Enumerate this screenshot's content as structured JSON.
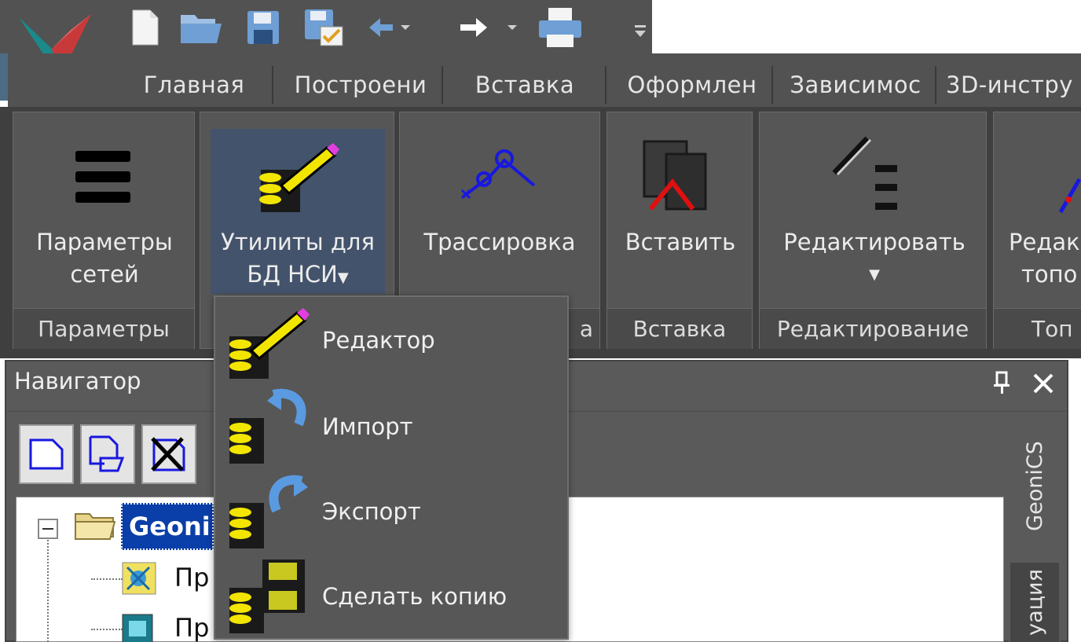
{
  "quick_access": {
    "icons": [
      "app-logo",
      "new-file-icon",
      "open-folder-icon",
      "save-icon",
      "save-as-icon",
      "undo-icon",
      "redo-icon",
      "print-icon",
      "customize-icon"
    ]
  },
  "tabs": [
    {
      "label": "Главная"
    },
    {
      "label": "Построени"
    },
    {
      "label": "Вставка"
    },
    {
      "label": "Оформлен"
    },
    {
      "label": "Зависимос"
    },
    {
      "label": "3D-инстру"
    }
  ],
  "ribbon": {
    "groups": [
      {
        "label": "Параметры",
        "button": {
          "line1": "Параметры",
          "line2": "сетей"
        }
      },
      {
        "label": "",
        "button": {
          "line1": "Утилиты для",
          "line2": "БД НСИ"
        }
      },
      {
        "label": "а",
        "button": {
          "line1": "Трассировка",
          "line2": ""
        }
      },
      {
        "label": "Вставка",
        "button": {
          "line1": "Вставить",
          "line2": ""
        }
      },
      {
        "label": "Редактирование",
        "button": {
          "line1": "Редактировать",
          "line2": ""
        }
      },
      {
        "label": "Топ",
        "button": {
          "line1": "Редак",
          "line2": "топо"
        }
      }
    ]
  },
  "dropdown": {
    "items": [
      {
        "label": "Редактор"
      },
      {
        "label": "Импорт"
      },
      {
        "label": "Экспорт"
      },
      {
        "label": "Сделать копию"
      }
    ]
  },
  "navigator": {
    "title": "Навигатор",
    "pin_glyph": "ᵽ",
    "close_glyph": "✕",
    "tree": {
      "root_label": "Geoni",
      "child1_label": "Пр",
      "child2_label": "Пр"
    },
    "side_tabs": [
      {
        "label": "GeoniCS"
      },
      {
        "label": "уация"
      }
    ]
  },
  "colors": {
    "ribbon_bg": "#565656",
    "highlight": "#43536b",
    "db_yellow": "#f2e600"
  }
}
